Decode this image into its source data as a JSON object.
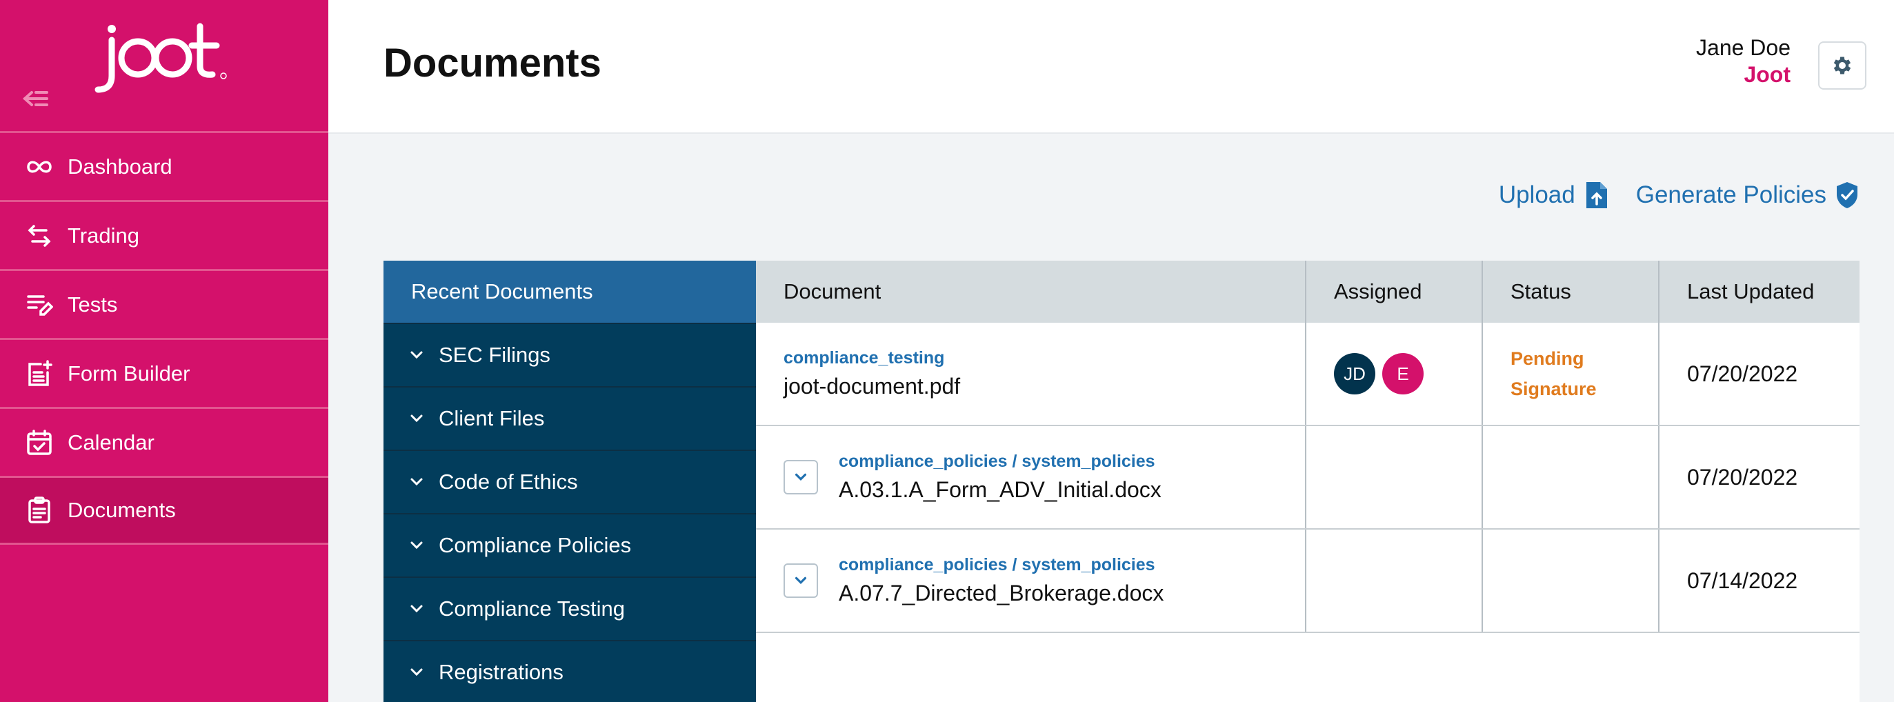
{
  "app": {
    "brand": "joot",
    "accent": "#d4116b",
    "navy": "#023d5c",
    "link": "#2070b0"
  },
  "sidebar": {
    "items": [
      {
        "label": "Dashboard",
        "icon": "infinity-icon"
      },
      {
        "label": "Trading",
        "icon": "arrows-swap-icon"
      },
      {
        "label": "Tests",
        "icon": "checklist-edit-icon"
      },
      {
        "label": "Form Builder",
        "icon": "form-add-icon"
      },
      {
        "label": "Calendar",
        "icon": "calendar-check-icon"
      },
      {
        "label": "Documents",
        "icon": "clipboard-icon",
        "active": true
      }
    ]
  },
  "header": {
    "title": "Documents",
    "user_name": "Jane Doe",
    "user_org": "Joot"
  },
  "actions": {
    "upload_label": "Upload",
    "generate_label": "Generate Policies"
  },
  "folders": {
    "header": "Recent Documents",
    "items": [
      "SEC Filings",
      "Client Files",
      "Code of Ethics",
      "Compliance Policies",
      "Compliance Testing",
      "Registrations"
    ]
  },
  "table": {
    "columns": [
      "Document",
      "Assigned",
      "Status",
      "Last Updated"
    ],
    "rows": [
      {
        "path": "compliance_testing",
        "name": "joot-document.pdf",
        "assigned": [
          "JD",
          "E"
        ],
        "status_line1": "Pending",
        "status_line2": "Signature",
        "updated": "07/20/2022"
      },
      {
        "path": "compliance_policies / system_policies",
        "name": "A.03.1.A_Form_ADV_Initial.docx",
        "assigned": [],
        "status_line1": "",
        "status_line2": "",
        "updated": "07/20/2022"
      },
      {
        "path": "compliance_policies / system_policies",
        "name": "A.07.7_Directed_Brokerage.docx",
        "assigned": [],
        "status_line1": "",
        "status_line2": "",
        "updated": "07/14/2022"
      }
    ]
  }
}
